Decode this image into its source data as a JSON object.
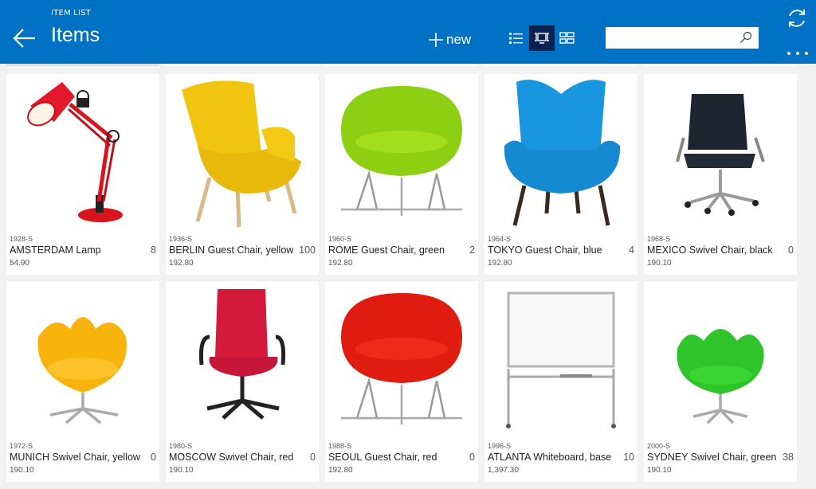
{
  "header": {
    "subtitle": "ITEM LIST",
    "title": "Items",
    "new_label": "new",
    "search": {
      "value": "",
      "placeholder": ""
    },
    "view_modes": [
      {
        "name": "list",
        "icon": "list-view-icon",
        "active": false
      },
      {
        "name": "tiles",
        "icon": "tile-view-icon",
        "active": true
      },
      {
        "name": "grid",
        "icon": "grid-view-icon",
        "active": false
      }
    ],
    "accent_color": "#0072c6",
    "active_view_color": "#0b2150"
  },
  "items": [
    {
      "code": "1928-S",
      "name": "AMSTERDAM Lamp",
      "qty": "8",
      "price": "54.90",
      "image": "red-desk-lamp"
    },
    {
      "code": "1936-S",
      "name": "BERLIN Guest Chair, yellow",
      "qty": "100",
      "price": "192.80",
      "image": "yellow-wingback-chair"
    },
    {
      "code": "1960-S",
      "name": "ROME Guest Chair, green",
      "qty": "2",
      "price": "192.80",
      "image": "green-tub-chair"
    },
    {
      "code": "1964-S",
      "name": "TOKYO Guest Chair, blue",
      "qty": "4",
      "price": "192.80",
      "image": "blue-wingback-chair"
    },
    {
      "code": "1968-S",
      "name": "MEXICO Swivel Chair, black",
      "qty": "0",
      "price": "190.10",
      "image": "black-office-chair"
    },
    {
      "code": "1972-S",
      "name": "MUNICH Swivel Chair, yellow",
      "qty": "0",
      "price": "190.10",
      "image": "yellow-swan-chair"
    },
    {
      "code": "1980-S",
      "name": "MOSCOW Swivel Chair, red",
      "qty": "0",
      "price": "190.10",
      "image": "red-office-chair"
    },
    {
      "code": "1988-S",
      "name": "SEOUL Guest Chair, red",
      "qty": "0",
      "price": "192.80",
      "image": "red-tub-chair"
    },
    {
      "code": "1996-S",
      "name": "ATLANTA Whiteboard, base",
      "qty": "10",
      "price": "1,397.30",
      "image": "whiteboard-on-stand"
    },
    {
      "code": "2000-S",
      "name": "SYDNEY Swivel Chair, green",
      "qty": "38",
      "price": "190.10",
      "image": "green-swan-chair"
    }
  ]
}
